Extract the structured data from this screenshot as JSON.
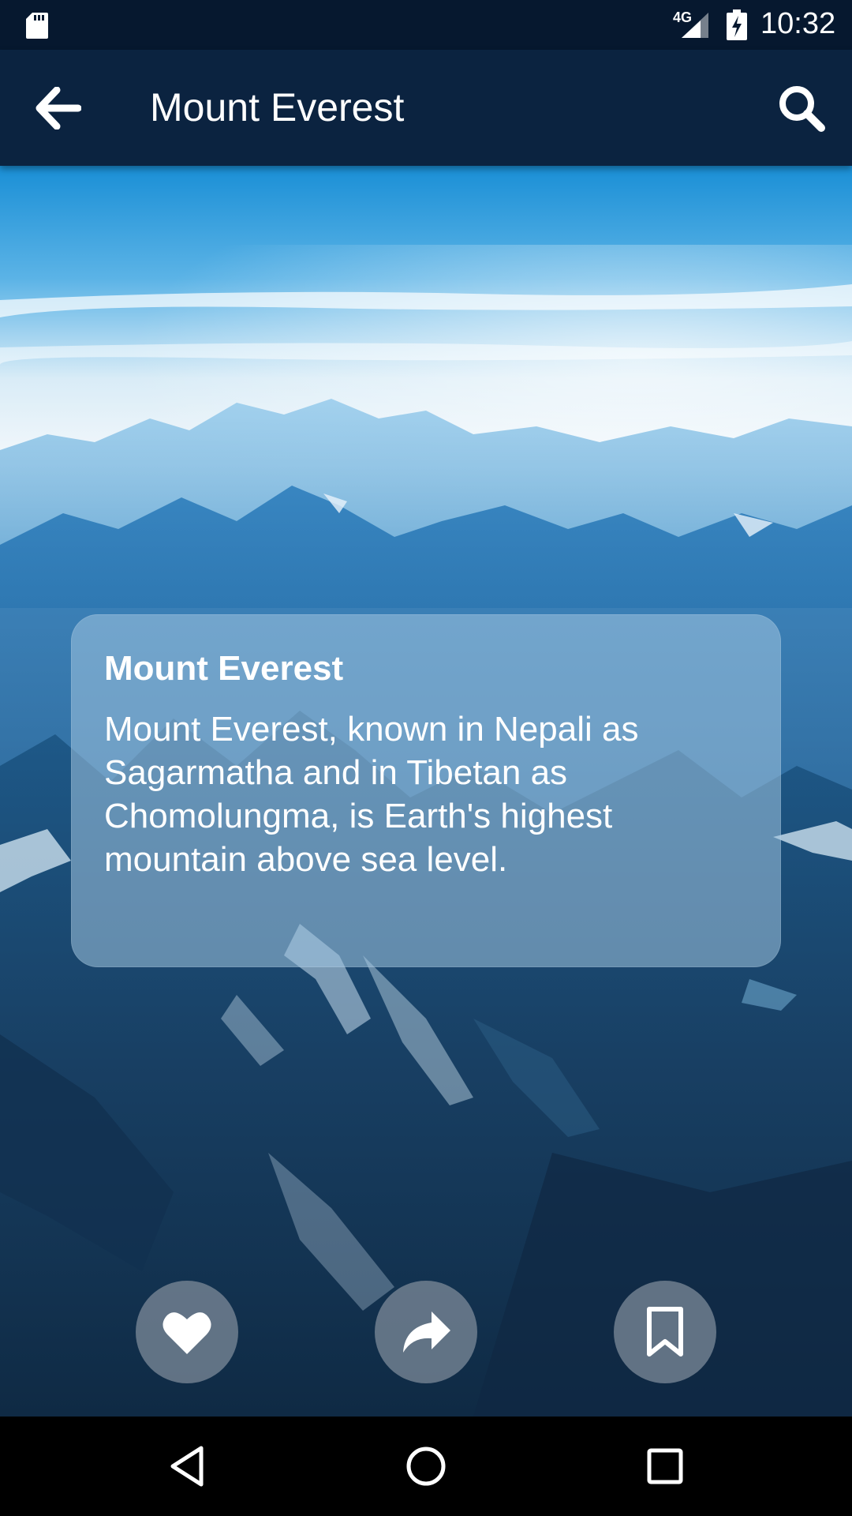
{
  "status_bar": {
    "network_type": "4G",
    "time": "10:32",
    "icons": [
      "sd-card-icon",
      "cell-signal-icon",
      "battery-charging-icon"
    ]
  },
  "app_bar": {
    "title": "Mount Everest",
    "icons": [
      "arrow-back-icon",
      "search-icon"
    ]
  },
  "card": {
    "title": "Mount Everest",
    "body": "Mount Everest, known in Nepali as Sagarmatha and in Tibetan as Chomolungma, is Earth's highest mountain above sea level."
  },
  "actions": [
    {
      "name": "like",
      "icon": "heart-icon"
    },
    {
      "name": "share",
      "icon": "share-arrow-icon"
    },
    {
      "name": "bookmark",
      "icon": "bookmark-icon"
    }
  ],
  "navigation_bar": {
    "icons": [
      "nav-back-icon",
      "nav-home-icon",
      "nav-recents-icon"
    ]
  },
  "colors": {
    "status_bar_bg": "#06182f",
    "app_bar_bg": "#0b2340",
    "sky_top": "#1a8fd6",
    "card_bg": "rgba(160,196,224,0.55)"
  }
}
